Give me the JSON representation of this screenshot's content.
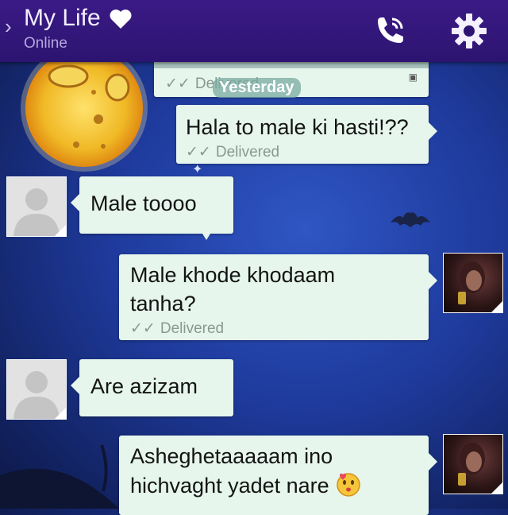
{
  "header": {
    "contact_name": "My Life",
    "status": "Online",
    "back_glyph": "›",
    "icons": [
      "chevron-back-icon",
      "heart-icon",
      "phone-call-icon",
      "gear-icon"
    ]
  },
  "conversation": {
    "date_divider": "Yesterday",
    "messages": [
      {
        "id": "m0",
        "direction": "outgoing",
        "text": "",
        "receipt": "Delivered",
        "partial": true
      },
      {
        "id": "m1",
        "direction": "outgoing",
        "text": "Hala to male ki hasti!??",
        "receipt": "Delivered"
      },
      {
        "id": "m2",
        "direction": "incoming",
        "text": "Male toooo"
      },
      {
        "id": "m3",
        "direction": "outgoing",
        "text_lines": [
          "Male khode khodaam",
          "tanha?"
        ],
        "receipt": "Delivered"
      },
      {
        "id": "m4",
        "direction": "incoming",
        "text": "Are azizam"
      },
      {
        "id": "m5",
        "direction": "outgoing",
        "text_lines": [
          "Asheghetaaaaam ino",
          "hichvaght yadet nare"
        ],
        "emoji": "kissing-face-icon"
      }
    ],
    "receipt_glyph": "✓✓"
  },
  "colors": {
    "header_bg": "#2c1470",
    "bubble_bg": "#e6f6ec",
    "receipt_text": "#8a9890",
    "background": "#1e3a9c"
  }
}
